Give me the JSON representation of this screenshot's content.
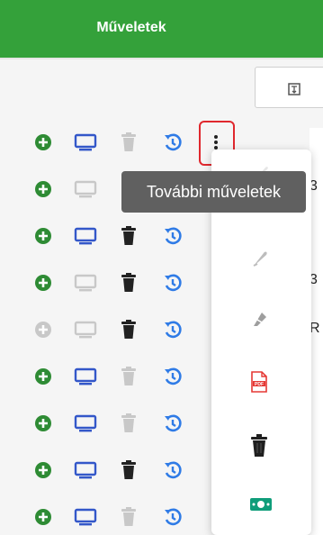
{
  "header": {
    "title": "Műveletek"
  },
  "tooltip": {
    "text": "További műveletek"
  },
  "right_edge": {
    "cells": [
      "3",
      "3",
      "R"
    ]
  },
  "colors": {
    "green": "#2e8b34",
    "blue": "#3357c9",
    "history_blue": "#2f7be6",
    "grey": "#c8c8c8",
    "dark": "#222222",
    "pdf_red": "#e53935",
    "money_teal": "#0f9d7a"
  },
  "rows": [
    {
      "add": "active",
      "monitor": "blue",
      "trash": "grey",
      "history": "blue"
    },
    {
      "add": "active",
      "monitor": "grey",
      "trash": "dark",
      "history": "blue"
    },
    {
      "add": "active",
      "monitor": "blue",
      "trash": "dark",
      "history": "blue"
    },
    {
      "add": "active",
      "monitor": "grey",
      "trash": "dark",
      "history": "blue"
    },
    {
      "add": "grey",
      "monitor": "grey",
      "trash": "dark",
      "history": "blue"
    },
    {
      "add": "active",
      "monitor": "blue",
      "trash": "grey",
      "history": "blue"
    },
    {
      "add": "active",
      "monitor": "blue",
      "trash": "grey",
      "history": "blue"
    },
    {
      "add": "active",
      "monitor": "blue",
      "trash": "dark",
      "history": "blue"
    },
    {
      "add": "active",
      "monitor": "blue",
      "trash": "grey",
      "history": "blue"
    }
  ],
  "menu_items": [
    {
      "icon": "feather-icon",
      "state": "disabled"
    },
    {
      "icon": "feather-icon",
      "state": "disabled"
    },
    {
      "icon": "signature-icon",
      "state": "disabled"
    },
    {
      "icon": "pdf-icon",
      "state": "active"
    },
    {
      "icon": "trash-icon",
      "state": "active"
    },
    {
      "icon": "money-icon",
      "state": "active"
    }
  ]
}
